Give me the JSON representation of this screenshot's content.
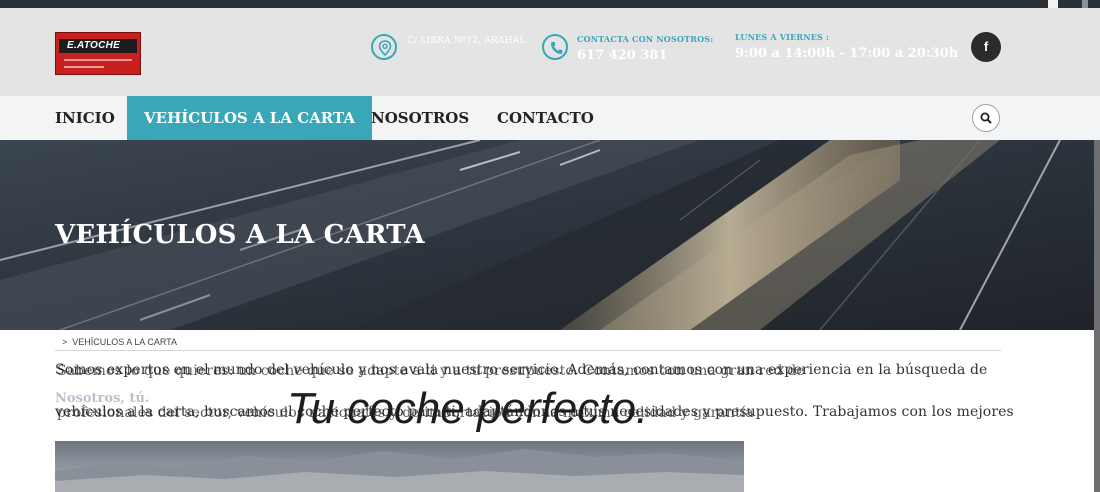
{
  "colors": {
    "accent": "#39a7b7",
    "header_bg": "#e4e4e4",
    "nav_bg": "#f3f4f5",
    "topbar": "#2b2f36"
  },
  "logo": {
    "name": "E.ATOCHE",
    "icon": "company-logo"
  },
  "header": {
    "address": {
      "icon": "map-pin-icon",
      "label": "C/ LIBRA Nº12, ARAHAL"
    },
    "contact": {
      "icon": "phone-icon",
      "label": "CONTACTA CON NOSOTROS:",
      "phone": "617 420 381"
    },
    "hours": {
      "label": "LUNES A VIERNES :",
      "value": "9:00 a 14:00h - 17:00 a 20:30h"
    },
    "social": {
      "facebook_label": "f",
      "icon": "facebook-icon"
    }
  },
  "nav": {
    "items": [
      {
        "label": "INICIO"
      },
      {
        "label": "VEHÍCULOS A LA CARTA"
      },
      {
        "label": "NOSOTROS"
      },
      {
        "label": "CONTACTO"
      }
    ],
    "search_icon": "search-icon"
  },
  "hero": {
    "title": "VEHÍCULOS A LA CARTA"
  },
  "breadcrumb": {
    "separator": ">",
    "current": "VEHÍCULOS A LA CARTA"
  },
  "content": {
    "line1a": "Somos expertos en el mundo del vehículo y nos avala nuestro servicio. Además, contamos con una experiencia en la búsqueda de",
    "line1b": "Sabemos lo que quieres: un coche que se adapte a ti y a tu presupuesto. Contamos con una gran red de",
    "strong": "Nosotros, tú.",
    "line2a": "vehículos a la carta, buscamos el coche perfecto para ti, adaptándonos a tus necesidades y presupuesto. Trabajamos con los mejores",
    "line2b": "profesionales del sector, vehículos nacionales y de importación con la máxima calidad y garantía",
    "slogan": "Tu coche perfecto."
  }
}
